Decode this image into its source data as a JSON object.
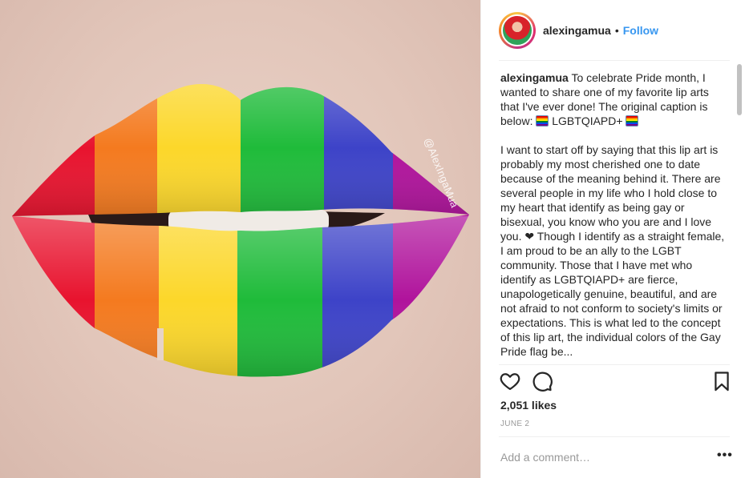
{
  "photo": {
    "watermark": "@AlexIngaMua",
    "stripe_colors": [
      "#e8132e",
      "#f47a1f",
      "#fcd72a",
      "#1fbb3a",
      "#3d43c8",
      "#b0139c"
    ]
  },
  "header": {
    "username": "alexingamua",
    "separator": "•",
    "follow_label": "Follow",
    "follow_color": "#3897f0"
  },
  "caption": {
    "username": "alexingamua",
    "intro": "To celebrate Pride month, I wanted to share one of my favorite lip arts that I've ever done! The original caption is below:",
    "tag": "LGBTQIAPD+",
    "body_1": "I want to start off by saying that this lip art is probably my most cherished one to date because of the meaning behind it. There are several people in my life who I hold close to my heart that identify as being gay or bisexual, you know who you are and I love you.",
    "heart": "❤",
    "body_2": "Though I identify as a straight female, I am proud to be an ally to the LGBT community. Those that I have met who identify as LGBTQIAPD+ are fierce, unapologetically genuine, beautiful, and are not afraid to not conform to society's limits or expectations. This is what led to the concept of this lip art, the individual colors of the Gay Pride flag be..."
  },
  "actions": {
    "like_icon": "heart-outline-icon",
    "comment_icon": "speech-bubble-icon",
    "save_icon": "bookmark-icon"
  },
  "likes": "2,051 likes",
  "date": "JUNE 2",
  "comment": {
    "placeholder": "Add a comment…",
    "more_label": "•••"
  }
}
